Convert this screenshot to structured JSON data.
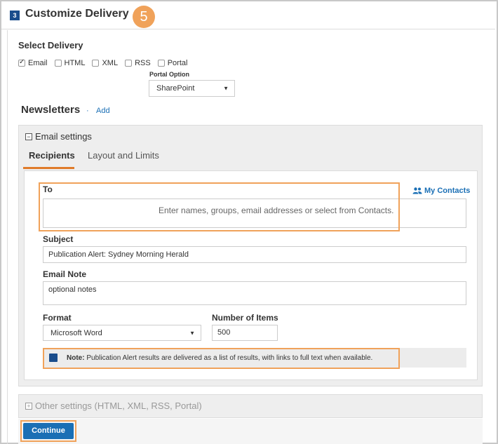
{
  "header": {
    "step": "3",
    "title": "Customize Delivery",
    "callout": "5"
  },
  "delivery": {
    "title": "Select Delivery",
    "options": [
      {
        "label": "Email",
        "checked": true
      },
      {
        "label": "HTML",
        "checked": false
      },
      {
        "label": "XML",
        "checked": false
      },
      {
        "label": "RSS",
        "checked": false
      },
      {
        "label": "Portal",
        "checked": false
      }
    ],
    "portal_option_label": "Portal Option",
    "portal_option_value": "SharePoint"
  },
  "newsletters": {
    "title": "Newsletters",
    "separator": "·",
    "add_label": "Add"
  },
  "email_settings": {
    "title": "Email settings",
    "tabs": [
      {
        "label": "Recipients"
      },
      {
        "label": "Layout and Limits"
      }
    ],
    "to_label": "To",
    "to_placeholder": "Enter names, groups, email addresses or select from Contacts.",
    "my_contacts": "My Contacts",
    "subject_label": "Subject",
    "subject_value": "Publication Alert: Sydney Morning Herald",
    "note_label": "Email Note",
    "note_value": "optional notes",
    "format_label": "Format",
    "format_value": "Microsoft Word",
    "items_label": "Number of Items",
    "items_value": "500",
    "info_note_bold": "Note:",
    "info_note_text": "Publication Alert results are delivered as a list of results, with links to full text when available."
  },
  "other_settings": {
    "title": "Other settings (HTML, XML, RSS, Portal)"
  },
  "actions": {
    "continue_label": "Continue"
  },
  "colors": {
    "accent": "#1a6fb5",
    "highlight": "#f0a25a",
    "tab_underline": "#e07b2a"
  }
}
